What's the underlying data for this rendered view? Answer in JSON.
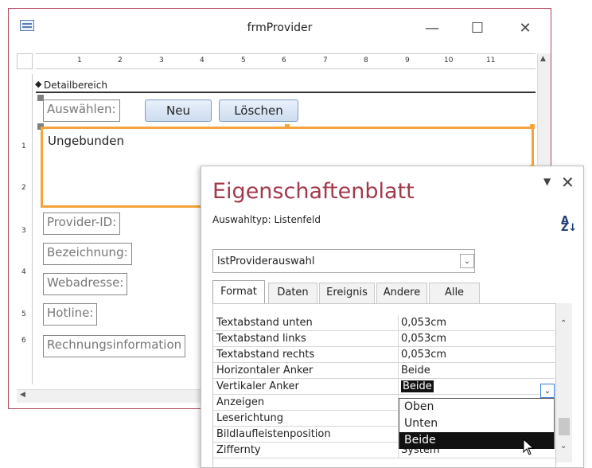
{
  "window": {
    "title": "frmProvider",
    "minimize_glyph": "—",
    "maximize_glyph": "☐",
    "close_glyph": "✕"
  },
  "ruler": {
    "h_ticks": [
      "1",
      "2",
      "3",
      "4",
      "5",
      "6",
      "7",
      "8",
      "9",
      "10",
      "11"
    ],
    "v_ticks": [
      "1",
      "2",
      "3",
      "4",
      "5",
      "6"
    ]
  },
  "form": {
    "section_label": "Detailbereich",
    "auswaehlen_label": "Auswählen:",
    "neu_button": "Neu",
    "loeschen_button": "Löschen",
    "listbox_text": "Ungebunden",
    "labels": [
      "Provider-ID:",
      "Bezeichnung:",
      "Webadresse:",
      "Hotline:",
      "Rechnungsinformation"
    ]
  },
  "sheet": {
    "title": "Eigenschaftenblatt",
    "selection_type_label": "Auswahltyp:",
    "selection_type_value": "Listenfeld",
    "combo_value": "lstProviderauswahl",
    "tabs": [
      "Format",
      "Daten",
      "Ereignis",
      "Andere",
      "Alle"
    ],
    "active_tab": "Format",
    "rows": [
      {
        "name": "Textabstand unten",
        "value": "0,053cm"
      },
      {
        "name": "Textabstand links",
        "value": "0,053cm"
      },
      {
        "name": "Textabstand rechts",
        "value": "0,053cm"
      },
      {
        "name": "Horizontaler Anker",
        "value": "Beide"
      },
      {
        "name": "Vertikaler Anker",
        "value": "Beide"
      },
      {
        "name": "Anzeigen",
        "value": ""
      },
      {
        "name": "Leserichtung",
        "value": ""
      },
      {
        "name": "Bildlaufleistenposition",
        "value": ""
      },
      {
        "name": "Ziffernty",
        "value": "System"
      }
    ],
    "dropdown_options": [
      "Oben",
      "Unten",
      "Beide"
    ],
    "dropdown_selected": "Beide"
  },
  "colors": {
    "window_border": "#b7455a",
    "sheet_title": "#a33a4b",
    "selection_orange": "#f5a33a"
  }
}
